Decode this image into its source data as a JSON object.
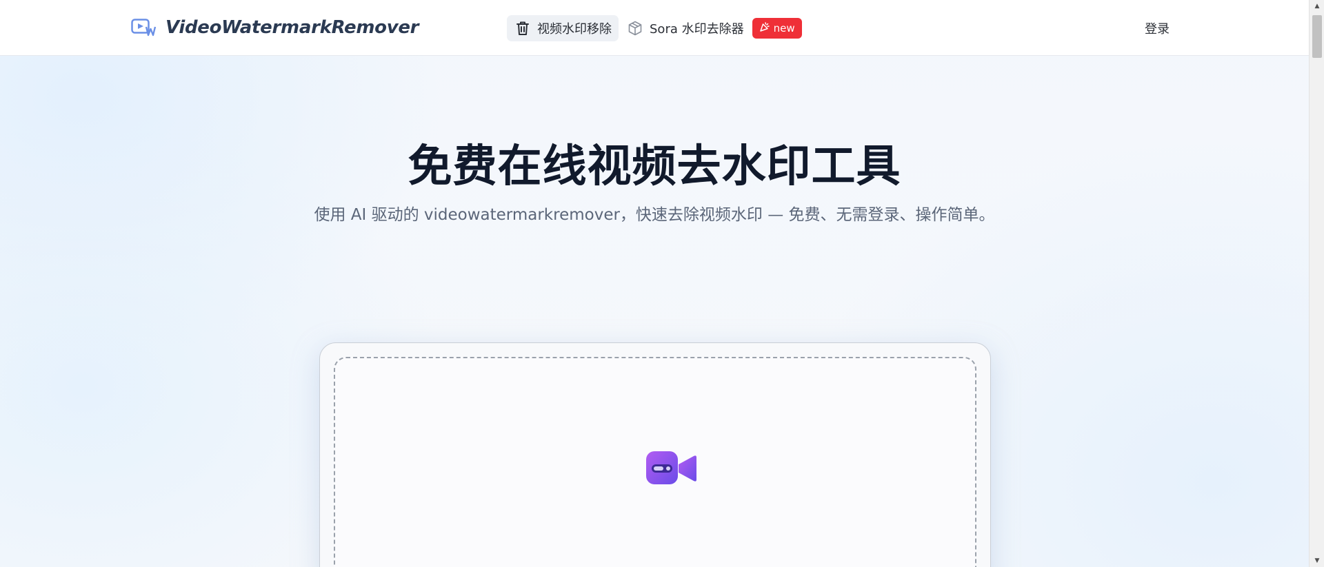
{
  "header": {
    "brand_name": "VideoWatermarkRemover",
    "nav": [
      {
        "label": "视频水印移除",
        "icon": "trash-icon",
        "active": true
      },
      {
        "label": "Sora 水印去除器",
        "icon": "cube-icon",
        "active": false,
        "badge": "new"
      }
    ],
    "login_label": "登录"
  },
  "hero": {
    "title": "免费在线视频去水印工具",
    "subtitle": "使用 AI 驱动的 videowatermarkremover，快速去除视频水印 — 免费、无需登录、操作简单。"
  },
  "upload": {
    "icon": "video-camera-icon"
  },
  "colors": {
    "badge_red": "#ef2f37",
    "title_dark": "#111a2c",
    "accent_purple": "#7a4cf0"
  }
}
